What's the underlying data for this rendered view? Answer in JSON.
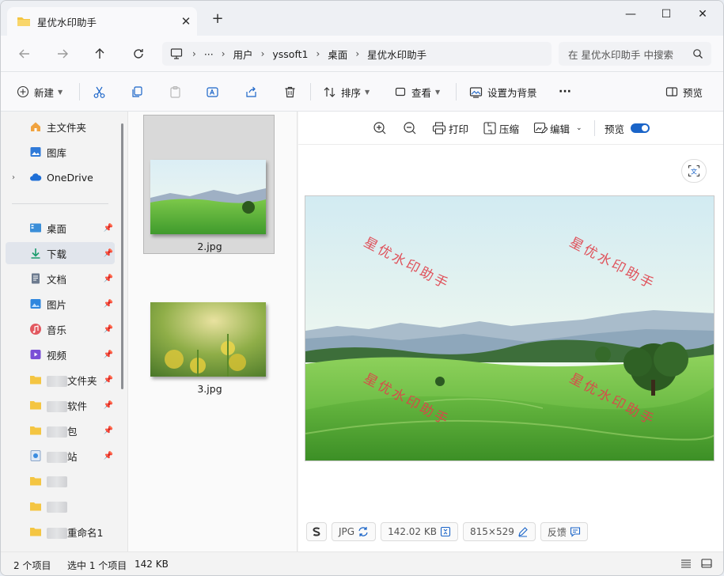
{
  "window": {
    "tab_title": "星优水印助手",
    "tab_close": "✕",
    "new_tab": "+",
    "minimize": "—",
    "maximize": "☐",
    "close": "✕"
  },
  "address": {
    "ellipsis": "···",
    "segments": [
      "用户",
      "yssoft1",
      "桌面",
      "星优水印助手"
    ],
    "separator": "›"
  },
  "search": {
    "placeholder": "在 星优水印助手 中搜索"
  },
  "toolbar": {
    "new_label": "新建",
    "sort_label": "排序",
    "view_label": "查看",
    "set_background_label": "设置为背景",
    "more_label": "···",
    "preview_label": "预览"
  },
  "sidebar": {
    "home": "主文件夹",
    "gallery": "图库",
    "onedrive": "OneDrive",
    "desktop": "桌面",
    "downloads": "下载",
    "documents": "文档",
    "pictures": "图片",
    "music": "音乐",
    "videos": "视频",
    "blurred1_suffix": "文件夹",
    "blurred2_suffix": "软件",
    "blurred3_suffix": "包",
    "blurred4_suffix": "站",
    "blurred7_suffix": "重命名1",
    "pin": "📌"
  },
  "files": [
    {
      "name": "2.jpg",
      "selected": true
    },
    {
      "name": "3.jpg",
      "selected": false
    }
  ],
  "preview": {
    "print_label": "打印",
    "compress_label": "压缩",
    "edit_label": "编辑",
    "preview_label": "预览",
    "watermark_text": "星优水印助手",
    "format": "JPG",
    "size": "142.02 KB",
    "dimensions": "815×529",
    "feedback": "反馈"
  },
  "status": {
    "item_count": "2 个项目",
    "selected": "选中 1 个项目",
    "selected_size": "142 KB"
  },
  "colors": {
    "accent": "#1a64c8",
    "folder": "#f4c542",
    "watermark": "#e0404a"
  }
}
